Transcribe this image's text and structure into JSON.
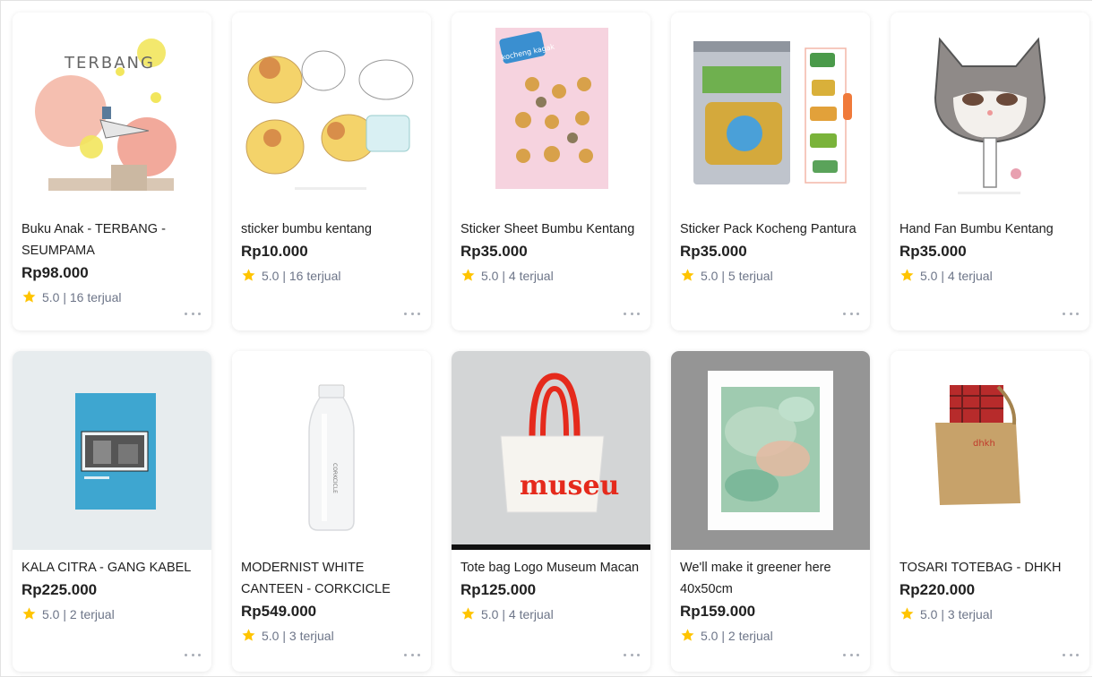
{
  "colors": {
    "star": "#ffc400",
    "price": "#212121",
    "meta": "#6d7588"
  },
  "products": [
    {
      "name": "Buku Anak - TERBANG - SEUMPAMA",
      "price": "Rp98.000",
      "rating": "5.0",
      "sold": "16 terjual",
      "image_text": "TERBANG",
      "icon": "more-options-icon"
    },
    {
      "name": "sticker bumbu kentang",
      "price": "Rp10.000",
      "rating": "5.0",
      "sold": "16 terjual",
      "icon": "more-options-icon"
    },
    {
      "name": "Sticker Sheet Bumbu Kentang",
      "price": "Rp35.000",
      "rating": "5.0",
      "sold": "4 terjual",
      "image_text": "kocheng kagak",
      "icon": "more-options-icon"
    },
    {
      "name": "Sticker Pack Kocheng Pantura",
      "price": "Rp35.000",
      "rating": "5.0",
      "sold": "5 terjual",
      "icon": "more-options-icon"
    },
    {
      "name": "Hand Fan Bumbu Kentang",
      "price": "Rp35.000",
      "rating": "5.0",
      "sold": "4 terjual",
      "icon": "more-options-icon"
    },
    {
      "name": "KALA CITRA - GANG KABEL",
      "price": "Rp225.000",
      "rating": "5.0",
      "sold": "2 terjual",
      "icon": "more-options-icon"
    },
    {
      "name": "MODERNIST WHITE CANTEEN - CORKCICLE",
      "price": "Rp549.000",
      "rating": "5.0",
      "sold": "3 terjual",
      "image_text": "CORKCICLE",
      "icon": "more-options-icon"
    },
    {
      "name": "Tote bag Logo Museum Macan",
      "price": "Rp125.000",
      "rating": "5.0",
      "sold": "4 terjual",
      "image_text": "museu",
      "icon": "more-options-icon"
    },
    {
      "name": "We'll make it greener here 40x50cm",
      "price": "Rp159.000",
      "rating": "5.0",
      "sold": "2 terjual",
      "icon": "more-options-icon"
    },
    {
      "name": "TOSARI TOTEBAG - DHKH",
      "price": "Rp220.000",
      "rating": "5.0",
      "sold": "3 terjual",
      "image_text": "dhkh",
      "icon": "more-options-icon"
    }
  ]
}
